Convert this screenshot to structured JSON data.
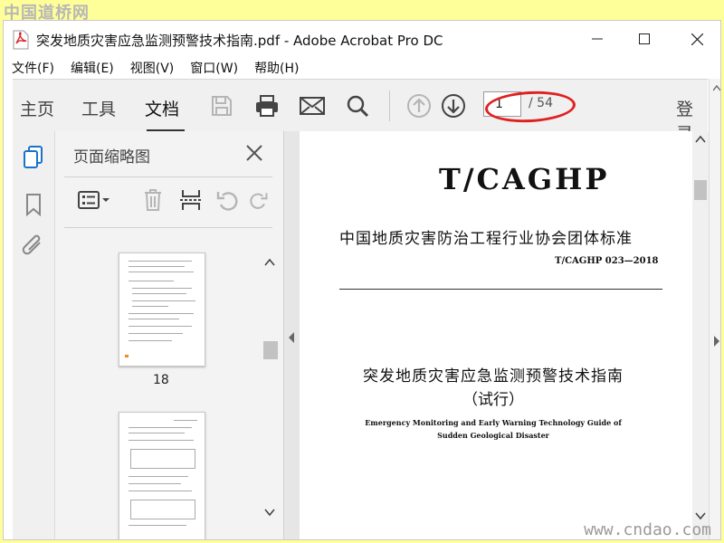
{
  "watermark": {
    "top": "中国道桥网",
    "bottom": "www.cndao.com"
  },
  "window": {
    "title": "突发地质灾害应急监测预警技术指南.pdf - Adobe Acrobat Pro DC"
  },
  "menu": [
    "文件(F)",
    "编辑(E)",
    "视图(V)",
    "窗口(W)",
    "帮助(H)"
  ],
  "toolbar": {
    "tabs": [
      "主页",
      "工具",
      "文档"
    ],
    "active_tab": "文档",
    "page_current": "1",
    "page_total": "/ 54",
    "login": "登录",
    "icons": [
      "save-icon",
      "print-icon",
      "email-icon",
      "search-icon",
      "page-up-icon",
      "page-down-icon"
    ]
  },
  "rail_icons": [
    "page-thumbnails-icon",
    "bookmark-icon",
    "attachment-icon"
  ],
  "thumbnail_panel": {
    "title": "页面缩略图",
    "page_labels": [
      "18"
    ],
    "tools": [
      "thumbnail-options-icon",
      "delete-page-icon",
      "extract-page-icon",
      "rotate-left-icon",
      "rotate-right-icon"
    ]
  },
  "document": {
    "code": "T/CAGHP",
    "association": "中国地质灾害防治工程行业协会团体标准",
    "standard_no": "T/CAGHP 023—2018",
    "title_cn": "突发地质灾害应急监测预警技术指南",
    "subtitle_cn": "（试行）",
    "title_en_line1": "Emergency Monitoring and Early Warning Technology Guide of",
    "title_en_line2": "Sudden Geological Disaster"
  },
  "colors": {
    "accent": "#1a73c9",
    "highlight_ellipse": "#e02020",
    "watermark_bg": "#ffff99"
  }
}
